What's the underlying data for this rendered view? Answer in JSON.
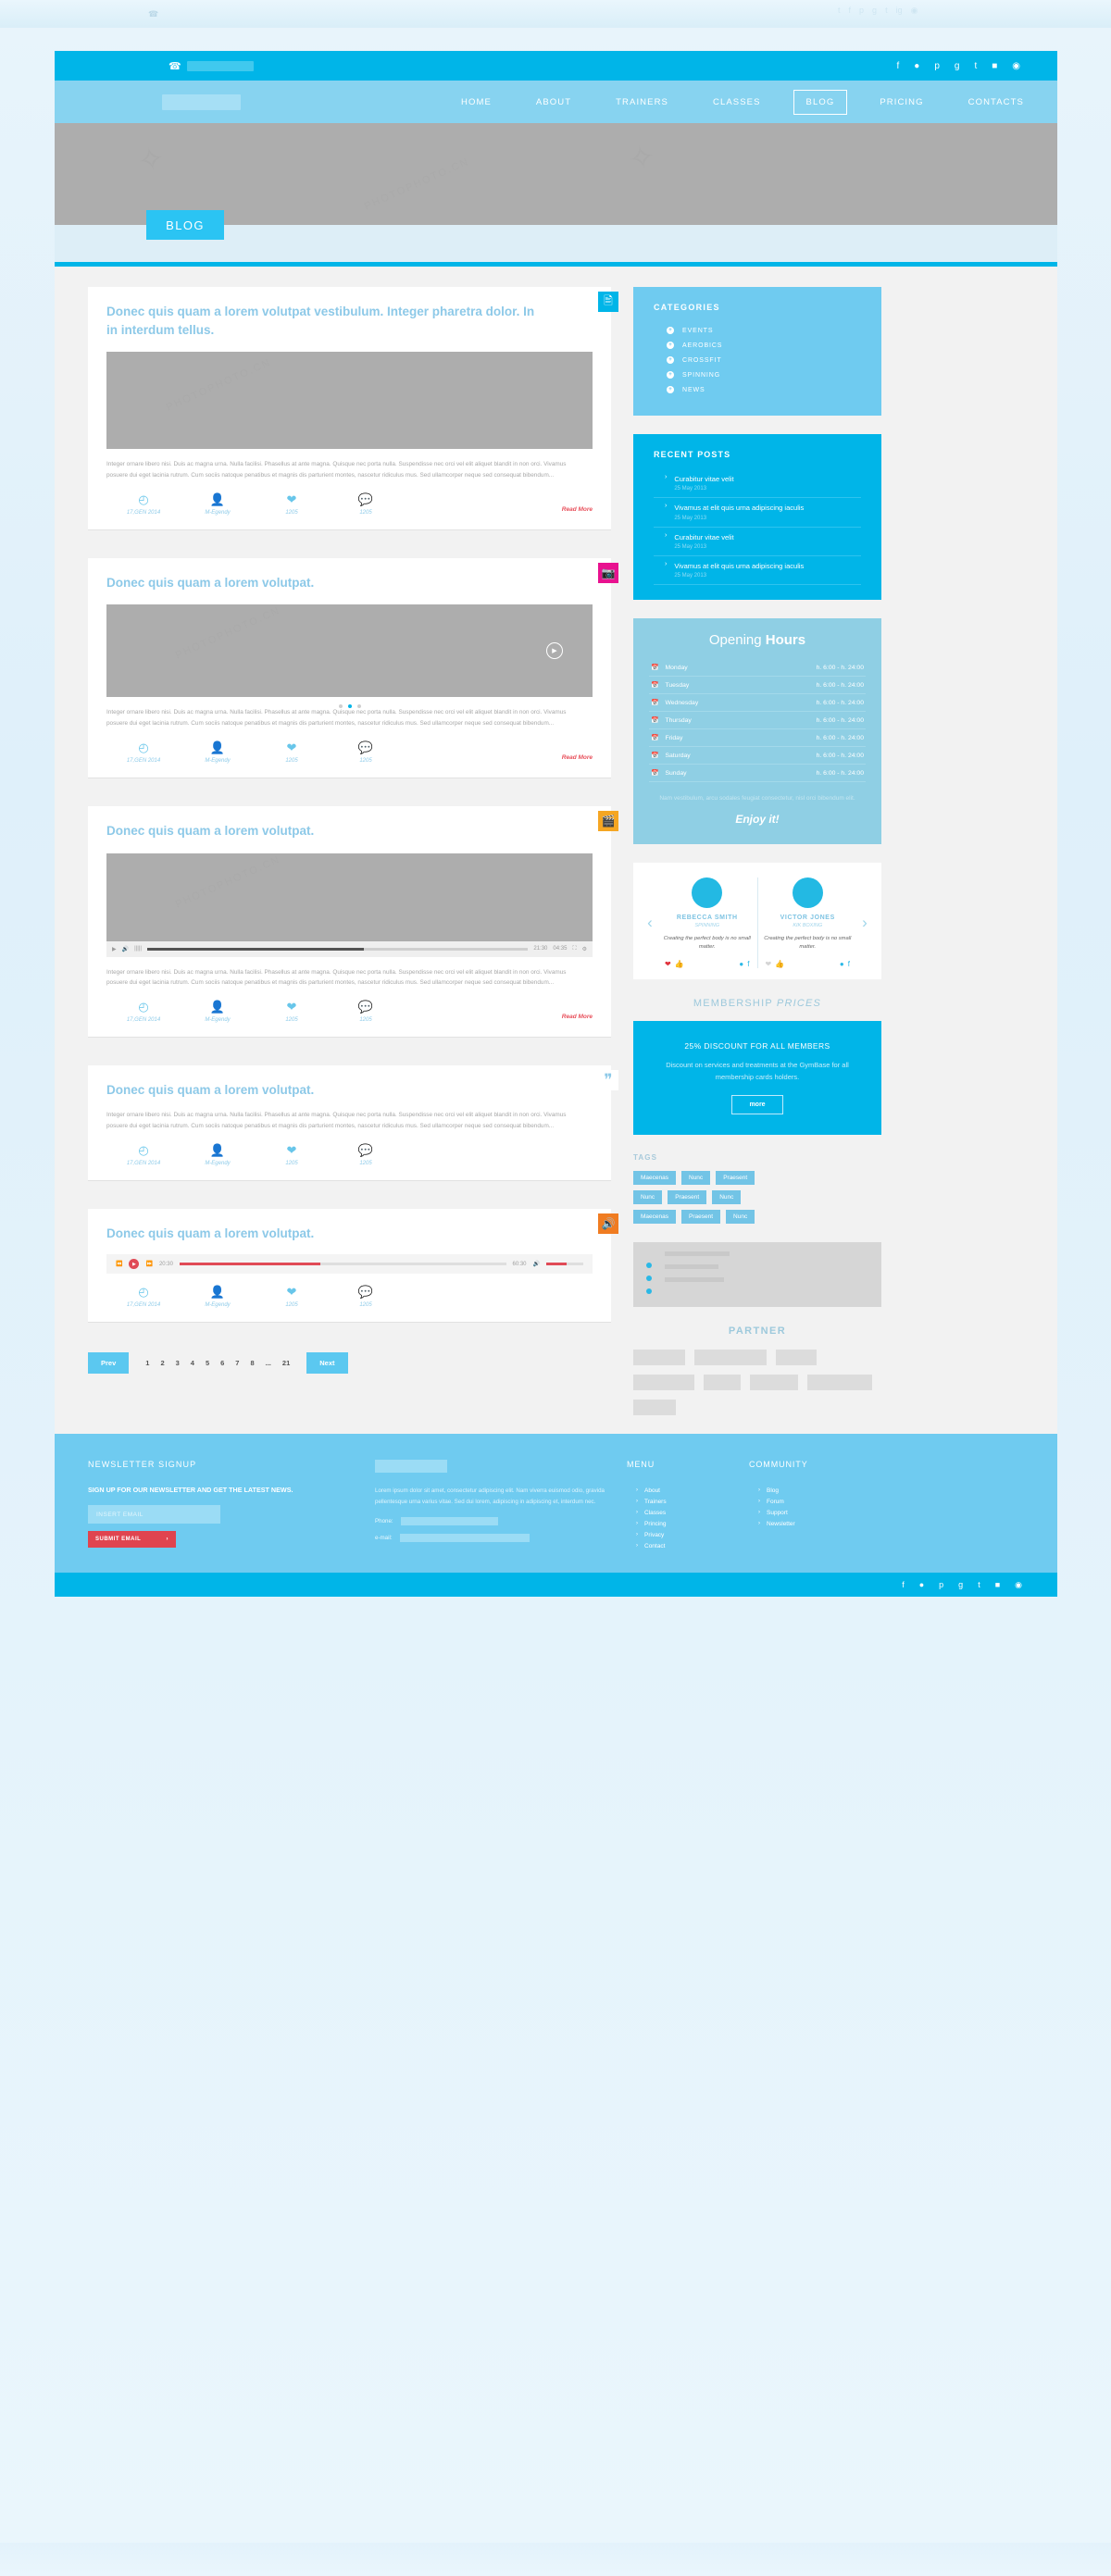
{
  "browser": {
    "social_icons": [
      "t",
      "f",
      "p",
      "g+",
      "t",
      "ig",
      "rss"
    ]
  },
  "header": {
    "phone_icon": "phone-icon",
    "social_icons": [
      "f",
      "t",
      "p",
      "g+",
      "t",
      "ig",
      "rss"
    ],
    "nav": [
      {
        "label": "HOME",
        "active": false
      },
      {
        "label": "ABOUT",
        "active": false
      },
      {
        "label": "TRAINERS",
        "active": false
      },
      {
        "label": "CLASSES",
        "active": false
      },
      {
        "label": "BLOG",
        "active": true
      },
      {
        "label": "PRICING",
        "active": false
      },
      {
        "label": "CONTACTS",
        "active": false
      }
    ]
  },
  "hero": {
    "tab_label": "BLOG"
  },
  "posts": [
    {
      "format": "article",
      "badge_icon": "document-icon",
      "title": "Donec quis quam a lorem volutpat vestibulum. Integer pharetra dolor. In in interdum tellus.",
      "excerpt": "Integer ornare libero nisi. Duis ac magna urna. Nulla facilisi. Phasellus at ante magna. Quisque nec porta nulla. Suspendisse nec orci vel elit aliquet blandit in non orci. Vivamus posuere dui eget lacinia rutrum. Cum sociis natoque penatibus et magnis dis parturient montes, nascetur ridiculus mus. Sed ullamcorper neque sed consequat bibendum...",
      "meta": {
        "date": "17,GEN 2014",
        "author": "M-Egendy",
        "likes": "1205",
        "comments": "1205"
      },
      "read_more": "Read More"
    },
    {
      "format": "gallery",
      "badge_icon": "image-icon",
      "title": "Donec quis quam a lorem volutpat.",
      "excerpt": "Integer ornare libero nisi. Duis ac magna urna. Nulla facilisi. Phasellus at ante magna. Quisque nec porta nulla. Suspendisse nec orci vel elit aliquet blandit in non orci. Vivamus posuere dui eget lacinia rutrum. Cum sociis natoque penatibus et magnis dis parturient montes, nascetur ridiculus mus. Sed ullamcorper neque sed consequat bibendum...",
      "meta": {
        "date": "17,GEN 2014",
        "author": "M-Egendy",
        "likes": "1205",
        "comments": "1205"
      },
      "read_more": "Read More"
    },
    {
      "format": "video",
      "badge_icon": "film-icon",
      "title": "Donec quis quam a lorem volutpat.",
      "player": {
        "current_time": "21:30",
        "total_time": "04:35"
      },
      "excerpt": "Integer ornare libero nisi. Duis ac magna urna. Nulla facilisi. Phasellus at ante magna. Quisque nec porta nulla. Suspendisse nec orci vel elit aliquet blandit in non orci. Vivamus posuere dui eget lacinia rutrum. Cum sociis natoque penatibus et magnis dis parturient montes, nascetur ridiculus mus. Sed ullamcorper neque sed consequat bibendum...",
      "meta": {
        "date": "17,GEN 2014",
        "author": "M-Egendy",
        "likes": "1205",
        "comments": "1205"
      },
      "read_more": "Read More"
    },
    {
      "format": "quote",
      "badge_icon": "quote-icon",
      "title": "Donec quis quam a lorem volutpat.",
      "excerpt": "Integer ornare libero nisi. Duis ac magna urna. Nulla facilisi. Phasellus at ante magna. Quisque nec porta nulla. Suspendisse nec orci vel elit aliquet blandit in non orci. Vivamus posuere dui eget lacinia rutrum. Cum sociis natoque penatibus et magnis dis parturient montes, nascetur ridiculus mus. Sed ullamcorper neque sed consequat bibendum...",
      "meta": {
        "date": "17,GEN 2014",
        "author": "M-Egendy",
        "likes": "1205",
        "comments": "1205"
      }
    },
    {
      "format": "audio",
      "badge_icon": "speaker-icon",
      "title": "Donec quis quam a lorem volutpat.",
      "player": {
        "current_time": "20:30",
        "total_time": "60:30"
      },
      "meta": {
        "date": "17,GEN 2014",
        "author": "M-Egendy",
        "likes": "1205",
        "comments": "1205"
      }
    }
  ],
  "pagination": {
    "prev": "Prev",
    "next": "Next",
    "pages": [
      "1",
      "2",
      "3",
      "4",
      "5",
      "6",
      "7",
      "8",
      "...",
      "21"
    ]
  },
  "sidebar": {
    "categories": {
      "title": "CATEGORIES",
      "items": [
        "EVENTS",
        "AEROBICS",
        "CROSSFIT",
        "SPINNING",
        "NEWS"
      ]
    },
    "recent_posts": {
      "title": "RECENT POSTS",
      "items": [
        {
          "title": "Curabitur vitae velit",
          "date": "25 May 2013"
        },
        {
          "title": "Vivamus at elit quis urna adipiscing iaculis",
          "date": "25 May 2013"
        },
        {
          "title": "Curabitur vitae velit",
          "date": "25 May 2013"
        },
        {
          "title": "Vivamus at elit quis urna adipiscing iaculis",
          "date": "25 May 2013"
        }
      ]
    },
    "hours": {
      "title_light": "Opening ",
      "title_bold": "Hours",
      "rows": [
        {
          "day": "Monday",
          "time": "h. 6:00 - h. 24:00"
        },
        {
          "day": "Tuesday",
          "time": "h. 6:00 - h. 24:00"
        },
        {
          "day": "Wednesday",
          "time": "h. 6:00 - h. 24:00"
        },
        {
          "day": "Thursday",
          "time": "h. 6:00 - h. 24:00"
        },
        {
          "day": "Friday",
          "time": "h. 6:00 - h. 24:00"
        },
        {
          "day": "Saturday",
          "time": "h. 6:00 - h. 24:00"
        },
        {
          "day": "Sunday",
          "time": "h. 6:00 - h. 24:00"
        }
      ],
      "note": "Nam vestibulum, arcu sodales feugiat consectetur, nisl orci bibendum elit.",
      "enjoy": "Enjoy it!"
    },
    "testimonials": [
      {
        "name": "REBECCA SMITH",
        "role": "SPINNING",
        "quote": "Creating the perfect body is no small matter.",
        "liked": true
      },
      {
        "name": "VICTOR JONES",
        "role": "KIK BOXING",
        "quote": "Creating the perfect body is no small matter.",
        "liked": false
      }
    ],
    "membership": {
      "title_plain": "MEMBERSHIP ",
      "title_italic": "PRICES",
      "headline": "25% DISCOUNT FOR ALL MEMBERS",
      "body": "Discount on services and treatments at the GymBase for all membership cards holders.",
      "button": "more"
    },
    "tags": {
      "title": "TAGS",
      "items": [
        "Maecenas",
        "Nunc",
        "Praesent",
        "Nunc",
        "Praesent",
        "Nunc",
        "Maecenas",
        "Praesent",
        "Nunc"
      ]
    },
    "partner": {
      "title": "PARTNER"
    }
  },
  "footer": {
    "newsletter": {
      "title": "NEWSLETTER SIGNUP",
      "subtitle": "SIGN UP FOR OUR NEWSLETTER AND GET THE LATEST NEWS.",
      "input_placeholder": "INSERT EMAIL",
      "submit_label": "SUBMIT EMAIL",
      "submit_arrow": "›"
    },
    "about": {
      "text": "Lorem ipsum dolor sit amet, consectetur adipiscing elit. Nam viverra euismod odio, gravida pellentesque urna varius vitae. Sed dui lorem, adipiscing in adipiscing et, interdum nec.",
      "phone_label": "Phone:",
      "email_label": "e-mail:"
    },
    "menu": {
      "title": "MENU",
      "items": [
        "About",
        "Trainers",
        "Classes",
        "Princing",
        "Privacy",
        "Contact"
      ]
    },
    "community": {
      "title": "COMMUNITY",
      "items": [
        "Blog",
        "Forum",
        "Support",
        "Newsletter"
      ]
    },
    "social_icons": [
      "f",
      "t",
      "p",
      "g+",
      "t",
      "ig",
      "rss"
    ]
  },
  "colors": {
    "accent": "#00b5e8",
    "light_blue": "#6fcbf0",
    "pale_blue": "#87d3f0",
    "red": "#e0444f",
    "orange": "#f07c21",
    "pink": "#e8128f",
    "yellow": "#f5a623"
  }
}
